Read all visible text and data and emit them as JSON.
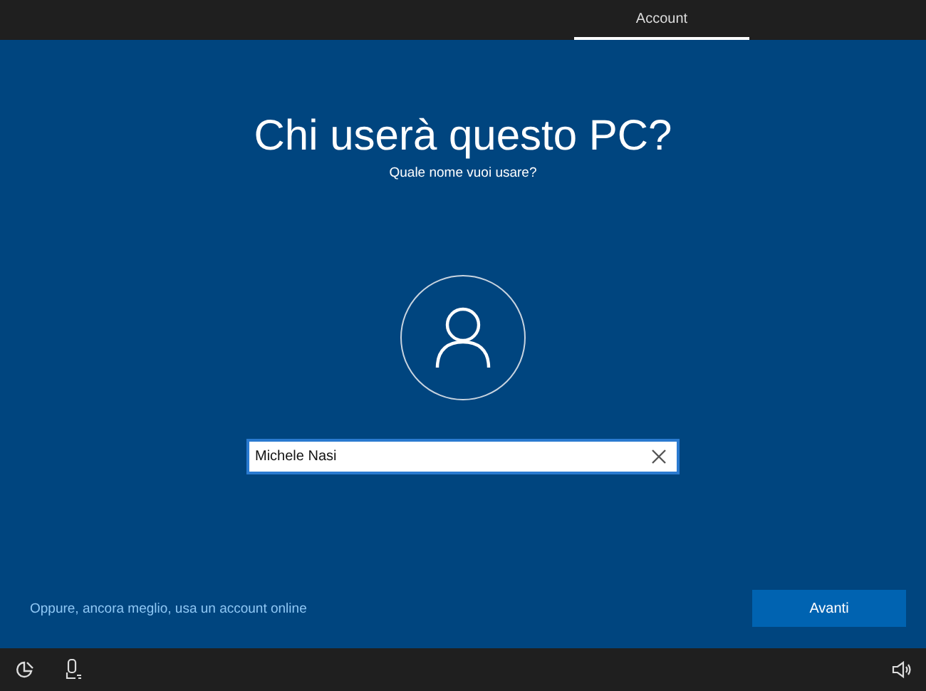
{
  "tabs": [
    {
      "label": "Account",
      "selected": true
    }
  ],
  "title": "Chi userà questo PC?",
  "subtitle": "Quale nome vuoi usare?",
  "name_field": {
    "value": "Michele Nasi"
  },
  "online_link": "Oppure, ancora meglio, usa un account online",
  "next_button": "Avanti"
}
